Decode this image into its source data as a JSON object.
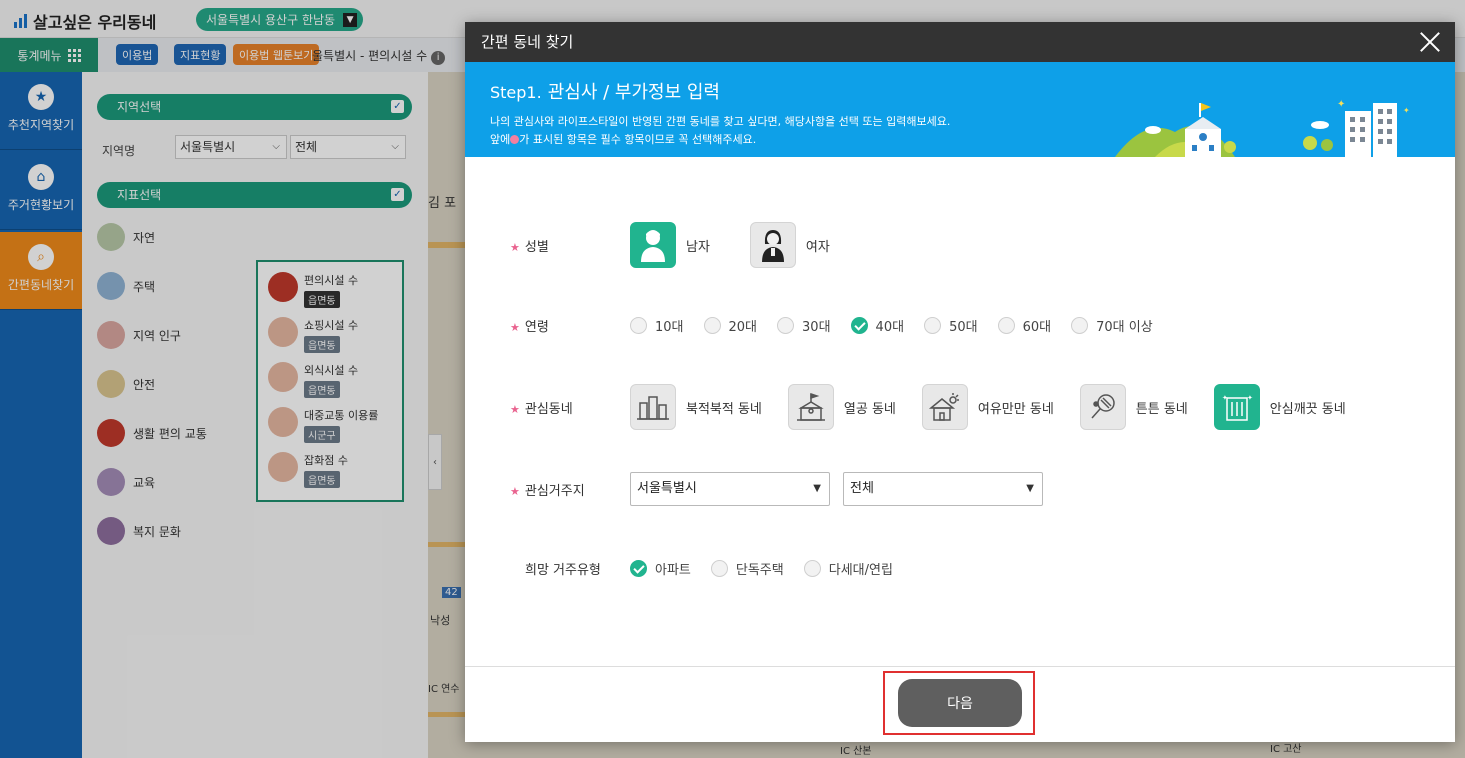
{
  "app": {
    "title": "살고싶은 우리동네",
    "region": "서울특별시 용산구 한남동",
    "menu_label": "통계메뉴",
    "tags": [
      {
        "label": "이용법",
        "color": "#1f67b5"
      },
      {
        "label": "지표현황",
        "color": "#1f67b5"
      },
      {
        "label": "이용법 웹툰보기",
        "color": "#e8822a"
      }
    ],
    "breadcrumb": "울특별시 - 편의시설 수",
    "side_nav": [
      "추천지역찾기",
      "주거현황보기",
      "간편동네찾기"
    ],
    "left_panel": {
      "region_section": "지역선택",
      "region_label": "지역명",
      "region_select": "서울특별시",
      "district_select": "전체",
      "index_section": "지표선택",
      "categories": [
        "자연",
        "주택",
        "지역 인구",
        "안전",
        "생활 편의 교통",
        "교육",
        "복지 문화"
      ],
      "sub_items": [
        {
          "label": "편의시설 수",
          "badge": "읍면동"
        },
        {
          "label": "쇼핑시설 수",
          "badge": "읍면동"
        },
        {
          "label": "외식시설 수",
          "badge": "읍면동"
        },
        {
          "label": "대중교통 이용률",
          "badge": "시군구"
        },
        {
          "label": "잡화점 수",
          "badge": "읍면동"
        }
      ],
      "map_labels": [
        "김 포",
        "42",
        "낙성",
        "IC 연수",
        "IC 산본",
        "IC 고산"
      ]
    }
  },
  "modal": {
    "title": "간편 동네 찾기",
    "step": "Step1.",
    "step_title": "관심사 / 부가정보 입력",
    "desc_line1": "나의 관심사와 라이프스타일이 반영된 간편 동네를 찾고 싶다면, 해당사항을 선택 또는 입력해보세요.",
    "desc_line2_pre": "앞에",
    "desc_line2_post": "가 표시된 항목은 필수 항목이므로 꼭 선택해주세요.",
    "gender": {
      "label": "성별",
      "options": [
        {
          "label": "남자",
          "selected": true
        },
        {
          "label": "여자",
          "selected": false
        }
      ]
    },
    "age": {
      "label": "연령",
      "options": [
        {
          "label": "10대",
          "selected": false
        },
        {
          "label": "20대",
          "selected": false
        },
        {
          "label": "30대",
          "selected": false
        },
        {
          "label": "40대",
          "selected": true
        },
        {
          "label": "50대",
          "selected": false
        },
        {
          "label": "60대",
          "selected": false
        },
        {
          "label": "70대 이상",
          "selected": false
        }
      ]
    },
    "interest": {
      "label": "관심동네",
      "options": [
        {
          "label": "북적북적 동네",
          "icon": "buildings-icon",
          "selected": false
        },
        {
          "label": "열공 동네",
          "icon": "school-icon",
          "selected": false
        },
        {
          "label": "여유만만 동네",
          "icon": "house-sun-icon",
          "selected": false
        },
        {
          "label": "튼튼 동네",
          "icon": "tennis-racket-icon",
          "selected": false
        },
        {
          "label": "안심깨끗 동네",
          "icon": "clean-building-icon",
          "selected": true
        }
      ]
    },
    "residence": {
      "label": "관심거주지",
      "city": "서울특별시",
      "district": "전체"
    },
    "housing": {
      "label": "희망 거주유형",
      "options": [
        {
          "label": "아파트",
          "selected": true
        },
        {
          "label": "단독주택",
          "selected": false
        },
        {
          "label": "다세대/연립",
          "selected": false
        }
      ]
    },
    "next_label": "다음",
    "colors": {
      "accent": "#21b48f",
      "banner": "#0ea0e8",
      "required": "#e9638f",
      "highlight": "#e03030"
    }
  }
}
